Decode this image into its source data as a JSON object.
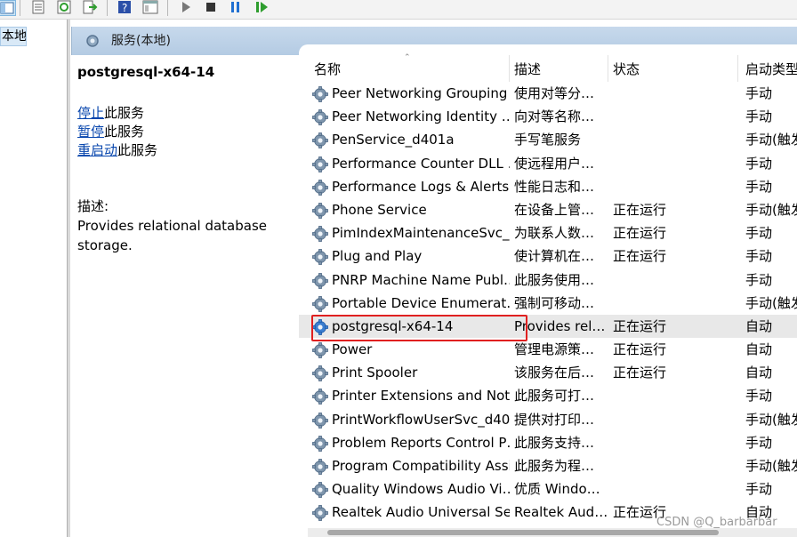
{
  "tree": {
    "selected_label": "本地)"
  },
  "header": {
    "title": "服务(本地)",
    "icon": "gear-icon"
  },
  "details": {
    "service_name": "postgresql-x64-14",
    "actions": [
      {
        "link": "停止",
        "suffix": "此服务"
      },
      {
        "link": "暂停",
        "suffix": "此服务"
      },
      {
        "link": "重启动",
        "suffix": "此服务"
      }
    ],
    "description_label": "描述:",
    "description_text": "Provides relational database storage."
  },
  "columns": {
    "name": "名称",
    "description": "描述",
    "status": "状态",
    "startup": "启动类型"
  },
  "rows": [
    {
      "name": "Peer Networking Grouping",
      "description": "使用对等分…",
      "status": "",
      "startup": "手动"
    },
    {
      "name": "Peer Networking Identity …",
      "description": "向对等名称…",
      "status": "",
      "startup": "手动"
    },
    {
      "name": "PenService_d401a",
      "description": "手写笔服务",
      "status": "",
      "startup": "手动(触发"
    },
    {
      "name": "Performance Counter DLL …",
      "description": "使远程用户…",
      "status": "",
      "startup": "手动"
    },
    {
      "name": "Performance Logs & Alerts",
      "description": "性能日志和…",
      "status": "",
      "startup": "手动"
    },
    {
      "name": "Phone Service",
      "description": "在设备上管…",
      "status": "正在运行",
      "startup": "手动(触发"
    },
    {
      "name": "PimIndexMaintenanceSvc_…",
      "description": "为联系人数…",
      "status": "正在运行",
      "startup": "手动"
    },
    {
      "name": "Plug and Play",
      "description": "使计算机在…",
      "status": "正在运行",
      "startup": "手动"
    },
    {
      "name": "PNRP Machine Name Publ…",
      "description": "此服务使用…",
      "status": "",
      "startup": "手动"
    },
    {
      "name": "Portable Device Enumerat…",
      "description": "强制可移动…",
      "status": "",
      "startup": "手动(触发"
    },
    {
      "name": "postgresql-x64-14",
      "description": "Provides rel…",
      "status": "正在运行",
      "startup": "自动"
    },
    {
      "name": "Power",
      "description": "管理电源策…",
      "status": "正在运行",
      "startup": "自动"
    },
    {
      "name": "Print Spooler",
      "description": "该服务在后…",
      "status": "正在运行",
      "startup": "自动"
    },
    {
      "name": "Printer Extensions and Noti…",
      "description": "此服务可打…",
      "status": "",
      "startup": "手动"
    },
    {
      "name": "PrintWorkflowUserSvc_d40…",
      "description": "提供对打印…",
      "status": "",
      "startup": "手动(触发"
    },
    {
      "name": "Problem Reports Control P…",
      "description": "此服务支持…",
      "status": "",
      "startup": "手动"
    },
    {
      "name": "Program Compatibility Assi…",
      "description": "此服务为程…",
      "status": "",
      "startup": "手动(触发"
    },
    {
      "name": "Quality Windows Audio Vi…",
      "description": "优质 Windo…",
      "status": "",
      "startup": "手动"
    },
    {
      "name": "Realtek Audio Universal Se…",
      "description": "Realtek Aud…",
      "status": "正在运行",
      "startup": "自动"
    }
  ],
  "selected_row_index": 10,
  "highlight_color": "#e02020",
  "watermark": "CSDN @Q_barbarbar"
}
